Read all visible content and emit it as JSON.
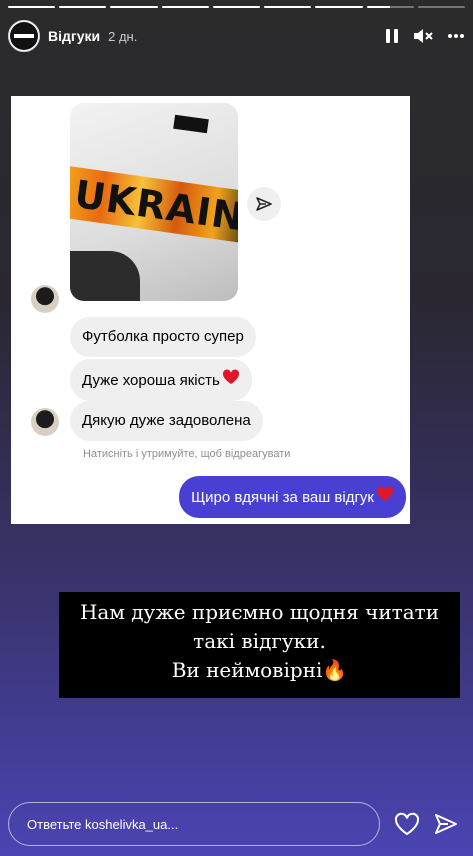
{
  "progress": [
    1,
    1,
    1,
    1,
    1,
    1,
    1,
    0.5,
    0
  ],
  "header": {
    "author": "Відгуки",
    "time": "2 дн."
  },
  "icons": {
    "pause": "pause-icon",
    "mute": "mute-icon",
    "more": "more-icon",
    "share": "share-icon",
    "heart": "heart-icon",
    "send": "send-icon"
  },
  "card": {
    "shirt_text": "UKRAINE",
    "messages": [
      {
        "text": "Футболка просто супер",
        "heart": false
      },
      {
        "text": "Дуже хороша якість",
        "heart": true
      },
      {
        "text": "Дякую дуже задоволена",
        "heart": false
      }
    ],
    "hint": "Натисніть і утримуйте, щоб відреагувати",
    "reply": {
      "text": "Щиро вдячні за ваш відгук",
      "heart": true
    }
  },
  "caption": {
    "line1": "Нам дуже приємно щодня читати",
    "line2": "такі відгуки.",
    "line3": "Ви неймовірні🔥"
  },
  "footer": {
    "placeholder": "Ответьте koshelivka_ua..."
  },
  "colors": {
    "accent": "#4a3fd3",
    "bubble": "#efefef",
    "heart": "#e0162b"
  }
}
